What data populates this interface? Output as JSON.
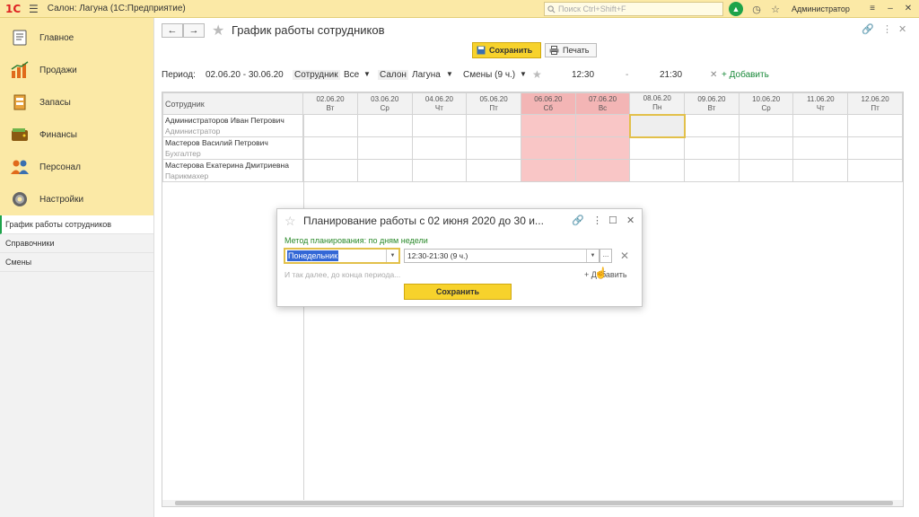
{
  "app": {
    "logo": "1С",
    "title": "Салон: Лагуна  (1С:Предприятие)",
    "search_placeholder": "Поиск Ctrl+Shift+F",
    "user": "Администратор"
  },
  "sidebar": {
    "main_items": [
      {
        "label": "Главное",
        "icon": "home-icon"
      },
      {
        "label": "Продажи",
        "icon": "sales-chart-icon"
      },
      {
        "label": "Запасы",
        "icon": "stock-icon"
      },
      {
        "label": "Финансы",
        "icon": "wallet-icon"
      },
      {
        "label": "Персонал",
        "icon": "people-icon"
      },
      {
        "label": "Настройки",
        "icon": "gear-icon"
      }
    ],
    "sub_items": [
      {
        "label": "График работы сотрудников",
        "active": true
      },
      {
        "label": "Справочники",
        "active": false
      },
      {
        "label": "Смены",
        "active": false
      }
    ]
  },
  "form": {
    "title": "График работы сотрудников",
    "save_label": "Сохранить",
    "print_label": "Печать",
    "filters": {
      "period_label": "Период:",
      "period_value": "02.06.20 - 30.06.20",
      "employee_label": "Сотрудник",
      "employee_value": "Все",
      "salon_label": "Салон",
      "salon_value": "Лагуна",
      "shifts_value": "Смены (9 ч.)",
      "time_from": "12:30",
      "time_sep": "-",
      "time_to": "21:30",
      "add_label": "+ Добавить"
    }
  },
  "grid": {
    "employee_header": "Сотрудник",
    "days": [
      {
        "date": "02.06.20",
        "dow": "Вт",
        "weekend": false
      },
      {
        "date": "03.06.20",
        "dow": "Ср",
        "weekend": false
      },
      {
        "date": "04.06.20",
        "dow": "Чт",
        "weekend": false
      },
      {
        "date": "05.06.20",
        "dow": "Пт",
        "weekend": false
      },
      {
        "date": "06.06.20",
        "dow": "Сб",
        "weekend": true
      },
      {
        "date": "07.06.20",
        "dow": "Вс",
        "weekend": true
      },
      {
        "date": "08.06.20",
        "dow": "Пн",
        "weekend": false
      },
      {
        "date": "09.06.20",
        "dow": "Вт",
        "weekend": false
      },
      {
        "date": "10.06.20",
        "dow": "Ср",
        "weekend": false
      },
      {
        "date": "11.06.20",
        "dow": "Чт",
        "weekend": false
      },
      {
        "date": "12.06.20",
        "dow": "Пт",
        "weekend": false
      }
    ],
    "employees": [
      {
        "name": "Администраторов Иван Петрович",
        "role": "Администратор"
      },
      {
        "name": "Мастеров Василий Петрович",
        "role": "Бухгалтер"
      },
      {
        "name": "Мастерова Екатерина Дмитриевна",
        "role": "Парикмахер"
      }
    ]
  },
  "dialog": {
    "title": "Планирование работы с 02 июня 2020 до 30 и...",
    "method": "Метод планирования: по дням недели",
    "day_value": "Понедельник",
    "shift_value": "12:30-21:30 (9 ч.)",
    "more_label": "...",
    "hint": "И так далее, до конца периода...",
    "add_label": "+ Добавить",
    "save_label": "Сохранить"
  }
}
